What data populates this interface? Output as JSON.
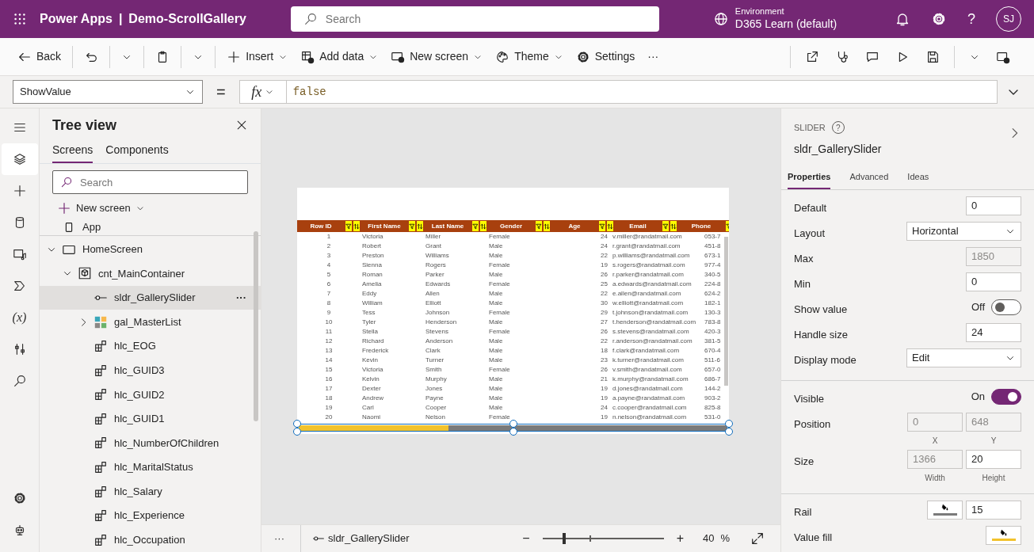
{
  "app_bar": {
    "app_name": "Power Apps",
    "divider": "|",
    "title": "Demo-ScrollGallery",
    "search": {
      "placeholder": "Search"
    },
    "environment_label": "Environment",
    "environment": "D365 Learn (default)",
    "help": "?",
    "avatar": "SJ"
  },
  "command_bar": {
    "left_groups": [
      [
        {
          "kind": "back",
          "label": "Back"
        }
      ],
      [
        {
          "kind": "undo",
          "split": true
        }
      ],
      [
        {
          "kind": "paste",
          "split": true
        }
      ],
      [
        {
          "kind": "insert",
          "label": "Insert",
          "menu": true
        },
        {
          "kind": "add_data",
          "label": "Add data",
          "menu": true
        },
        {
          "kind": "new_screen",
          "label": "New screen",
          "menu": true
        },
        {
          "kind": "theme",
          "label": "Theme",
          "menu": true
        },
        {
          "kind": "settings",
          "label": "Settings"
        },
        {
          "kind": "more",
          "label": "···"
        }
      ]
    ],
    "right_groups": [
      [
        {
          "kind": "share"
        },
        {
          "kind": "checker"
        },
        {
          "kind": "comment"
        },
        {
          "kind": "play"
        },
        {
          "kind": "save",
          "split": true
        },
        {
          "kind": "publish"
        }
      ]
    ]
  },
  "formula_bar": {
    "property": "ShowValue",
    "equals": "=",
    "fx": "fx",
    "formula": "false"
  },
  "rail": [
    {
      "kind": "menu",
      "selected": false
    },
    {
      "kind": "tree",
      "selected": true
    },
    {
      "kind": "insert",
      "selected": false
    },
    {
      "kind": "data",
      "selected": false
    },
    {
      "kind": "media",
      "selected": false
    },
    {
      "kind": "flow",
      "selected": false
    },
    {
      "kind": "variables",
      "label": "(x)",
      "selected": false
    },
    {
      "kind": "tools",
      "selected": false
    },
    {
      "kind": "search",
      "selected": false
    }
  ],
  "rail_bottom": [
    {
      "kind": "settings",
      "selected": false
    },
    {
      "kind": "bot",
      "selected": false
    }
  ],
  "tree_view": {
    "title": "Tree view",
    "tabs": [
      {
        "label": "Screens",
        "selected": true
      },
      {
        "label": "Components",
        "selected": false
      }
    ],
    "search": {
      "placeholder": "Search"
    },
    "new_screen": "New screen",
    "items": [
      {
        "kind": "app",
        "label": "App",
        "selected": false
      },
      {
        "kind": "screen",
        "label": "HomeScreen",
        "selected": false,
        "expanded": true,
        "children": [
          {
            "kind": "container",
            "label": "cnt_MainContainer",
            "selected": false,
            "expanded": true,
            "children": [
              {
                "kind": "slider",
                "label": "sldr_GallerySlider",
                "selected": true,
                "actions": "···"
              },
              {
                "kind": "gallery",
                "label": "gal_MasterList",
                "selected": false,
                "expanded": false
              },
              {
                "kind": "label",
                "label": "hlc_EOG",
                "selected": false
              },
              {
                "kind": "label",
                "label": "hlc_GUID3",
                "selected": false
              },
              {
                "kind": "label",
                "label": "hlc_GUID2",
                "selected": false
              },
              {
                "kind": "label",
                "label": "hlc_GUID1",
                "selected": false
              },
              {
                "kind": "label",
                "label": "hlc_NumberOfChildren",
                "selected": false
              },
              {
                "kind": "label",
                "label": "hlc_MaritalStatus",
                "selected": false
              },
              {
                "kind": "label",
                "label": "hlc_Salary",
                "selected": false
              },
              {
                "kind": "label",
                "label": "hlc_Experience",
                "selected": false
              },
              {
                "kind": "label",
                "label": "hlc_Occupation",
                "selected": false
              }
            ]
          }
        ]
      }
    ]
  },
  "canvas": {
    "gallery": {
      "columns": [
        "Row ID",
        "First Name",
        "Last Name",
        "Gender",
        "Age",
        "Email",
        "Phone"
      ],
      "rows": [
        [
          "1",
          "Victoria",
          "Miller",
          "Female",
          "24",
          "v.miller@randatmail.com",
          "053-7"
        ],
        [
          "2",
          "Robert",
          "Grant",
          "Male",
          "24",
          "r.grant@randatmail.com",
          "451-8"
        ],
        [
          "3",
          "Preston",
          "Williams",
          "Male",
          "22",
          "p.williams@randatmail.com",
          "673-1"
        ],
        [
          "4",
          "Sienna",
          "Rogers",
          "Female",
          "19",
          "s.rogers@randatmail.com",
          "977-4"
        ],
        [
          "5",
          "Roman",
          "Parker",
          "Male",
          "26",
          "r.parker@randatmail.com",
          "340-5"
        ],
        [
          "6",
          "Amelia",
          "Edwards",
          "Female",
          "25",
          "a.edwards@randatmail.com",
          "224-8"
        ],
        [
          "7",
          "Eddy",
          "Allen",
          "Male",
          "22",
          "e.allen@randatmail.com",
          "624-2"
        ],
        [
          "8",
          "William",
          "Elliott",
          "Male",
          "30",
          "w.elliott@randatmail.com",
          "182-1"
        ],
        [
          "9",
          "Tess",
          "Johnson",
          "Female",
          "29",
          "t.johnson@randatmail.com",
          "130-3"
        ],
        [
          "10",
          "Tyler",
          "Henderson",
          "Male",
          "27",
          "t.henderson@randatmail.com",
          "783-8"
        ],
        [
          "11",
          "Stella",
          "Stevens",
          "Female",
          "26",
          "s.stevens@randatmail.com",
          "420-3"
        ],
        [
          "12",
          "Richard",
          "Anderson",
          "Male",
          "22",
          "r.anderson@randatmail.com",
          "381-5"
        ],
        [
          "13",
          "Frederick",
          "Clark",
          "Male",
          "18",
          "f.clark@randatmail.com",
          "670-4"
        ],
        [
          "14",
          "Kevin",
          "Turner",
          "Male",
          "23",
          "k.turner@randatmail.com",
          "511-6"
        ],
        [
          "15",
          "Victoria",
          "Smith",
          "Female",
          "26",
          "v.smith@randatmail.com",
          "657-0"
        ],
        [
          "16",
          "Kelvin",
          "Murphy",
          "Male",
          "21",
          "k.murphy@randatmail.com",
          "686-7"
        ],
        [
          "17",
          "Dexter",
          "Jones",
          "Male",
          "19",
          "d.jones@randatmail.com",
          "144-2"
        ],
        [
          "18",
          "Andrew",
          "Payne",
          "Male",
          "19",
          "a.payne@randatmail.com",
          "903-2"
        ],
        [
          "19",
          "Carl",
          "Cooper",
          "Male",
          "24",
          "c.cooper@randatmail.com",
          "825-8"
        ],
        [
          "20",
          "Naomi",
          "Nelson",
          "Female",
          "19",
          "n.nelson@randatmail.com",
          "531-0"
        ]
      ]
    },
    "slider": {
      "level": 0.35
    }
  },
  "status_bar": {
    "more": "···",
    "breadcrumb": "sldr_GallerySlider",
    "zoom_out": "−",
    "zoom_in": "+",
    "zoom_slider": {
      "level": 0.18
    },
    "zoom": "40",
    "percent": "%"
  },
  "properties": {
    "type": "SLIDER",
    "help": "?",
    "name": "sldr_GallerySlider",
    "tabs": [
      {
        "label": "Properties",
        "selected": true
      },
      {
        "label": "Advanced",
        "selected": false
      },
      {
        "label": "Ideas",
        "selected": false
      }
    ],
    "sections": [
      {
        "rows": [
          {
            "kind": "input",
            "label": "Default",
            "value": "0",
            "disabled": false
          },
          {
            "kind": "dropdown",
            "label": "Layout",
            "value": "Horizontal"
          },
          {
            "kind": "input",
            "label": "Max",
            "value": "1850",
            "disabled": true
          },
          {
            "kind": "input",
            "label": "Min",
            "value": "0",
            "disabled": false
          },
          {
            "kind": "toggle",
            "label": "Show value",
            "state": "Off",
            "on": false
          },
          {
            "kind": "input",
            "label": "Handle size",
            "value": "24",
            "disabled": false
          },
          {
            "kind": "dropdown",
            "label": "Display mode",
            "value": "Edit"
          }
        ]
      },
      {
        "rows": [
          {
            "kind": "toggle",
            "label": "Visible",
            "state": "On",
            "on": true
          },
          {
            "kind": "pair",
            "label": "Position",
            "fields": [
              {
                "value": "0",
                "caption": "X",
                "disabled": true
              },
              {
                "value": "648",
                "caption": "Y",
                "disabled": true
              }
            ]
          },
          {
            "kind": "pair",
            "label": "Size",
            "fields": [
              {
                "value": "1366",
                "caption": "Width",
                "disabled": true
              },
              {
                "value": "20",
                "caption": "Height",
                "disabled": false
              }
            ]
          }
        ]
      },
      {
        "rows": [
          {
            "kind": "color",
            "label": "Rail",
            "color": "#7a7a7a",
            "value": "15"
          },
          {
            "kind": "color",
            "label": "Value fill",
            "color": "#f2c22c"
          }
        ]
      }
    ]
  }
}
